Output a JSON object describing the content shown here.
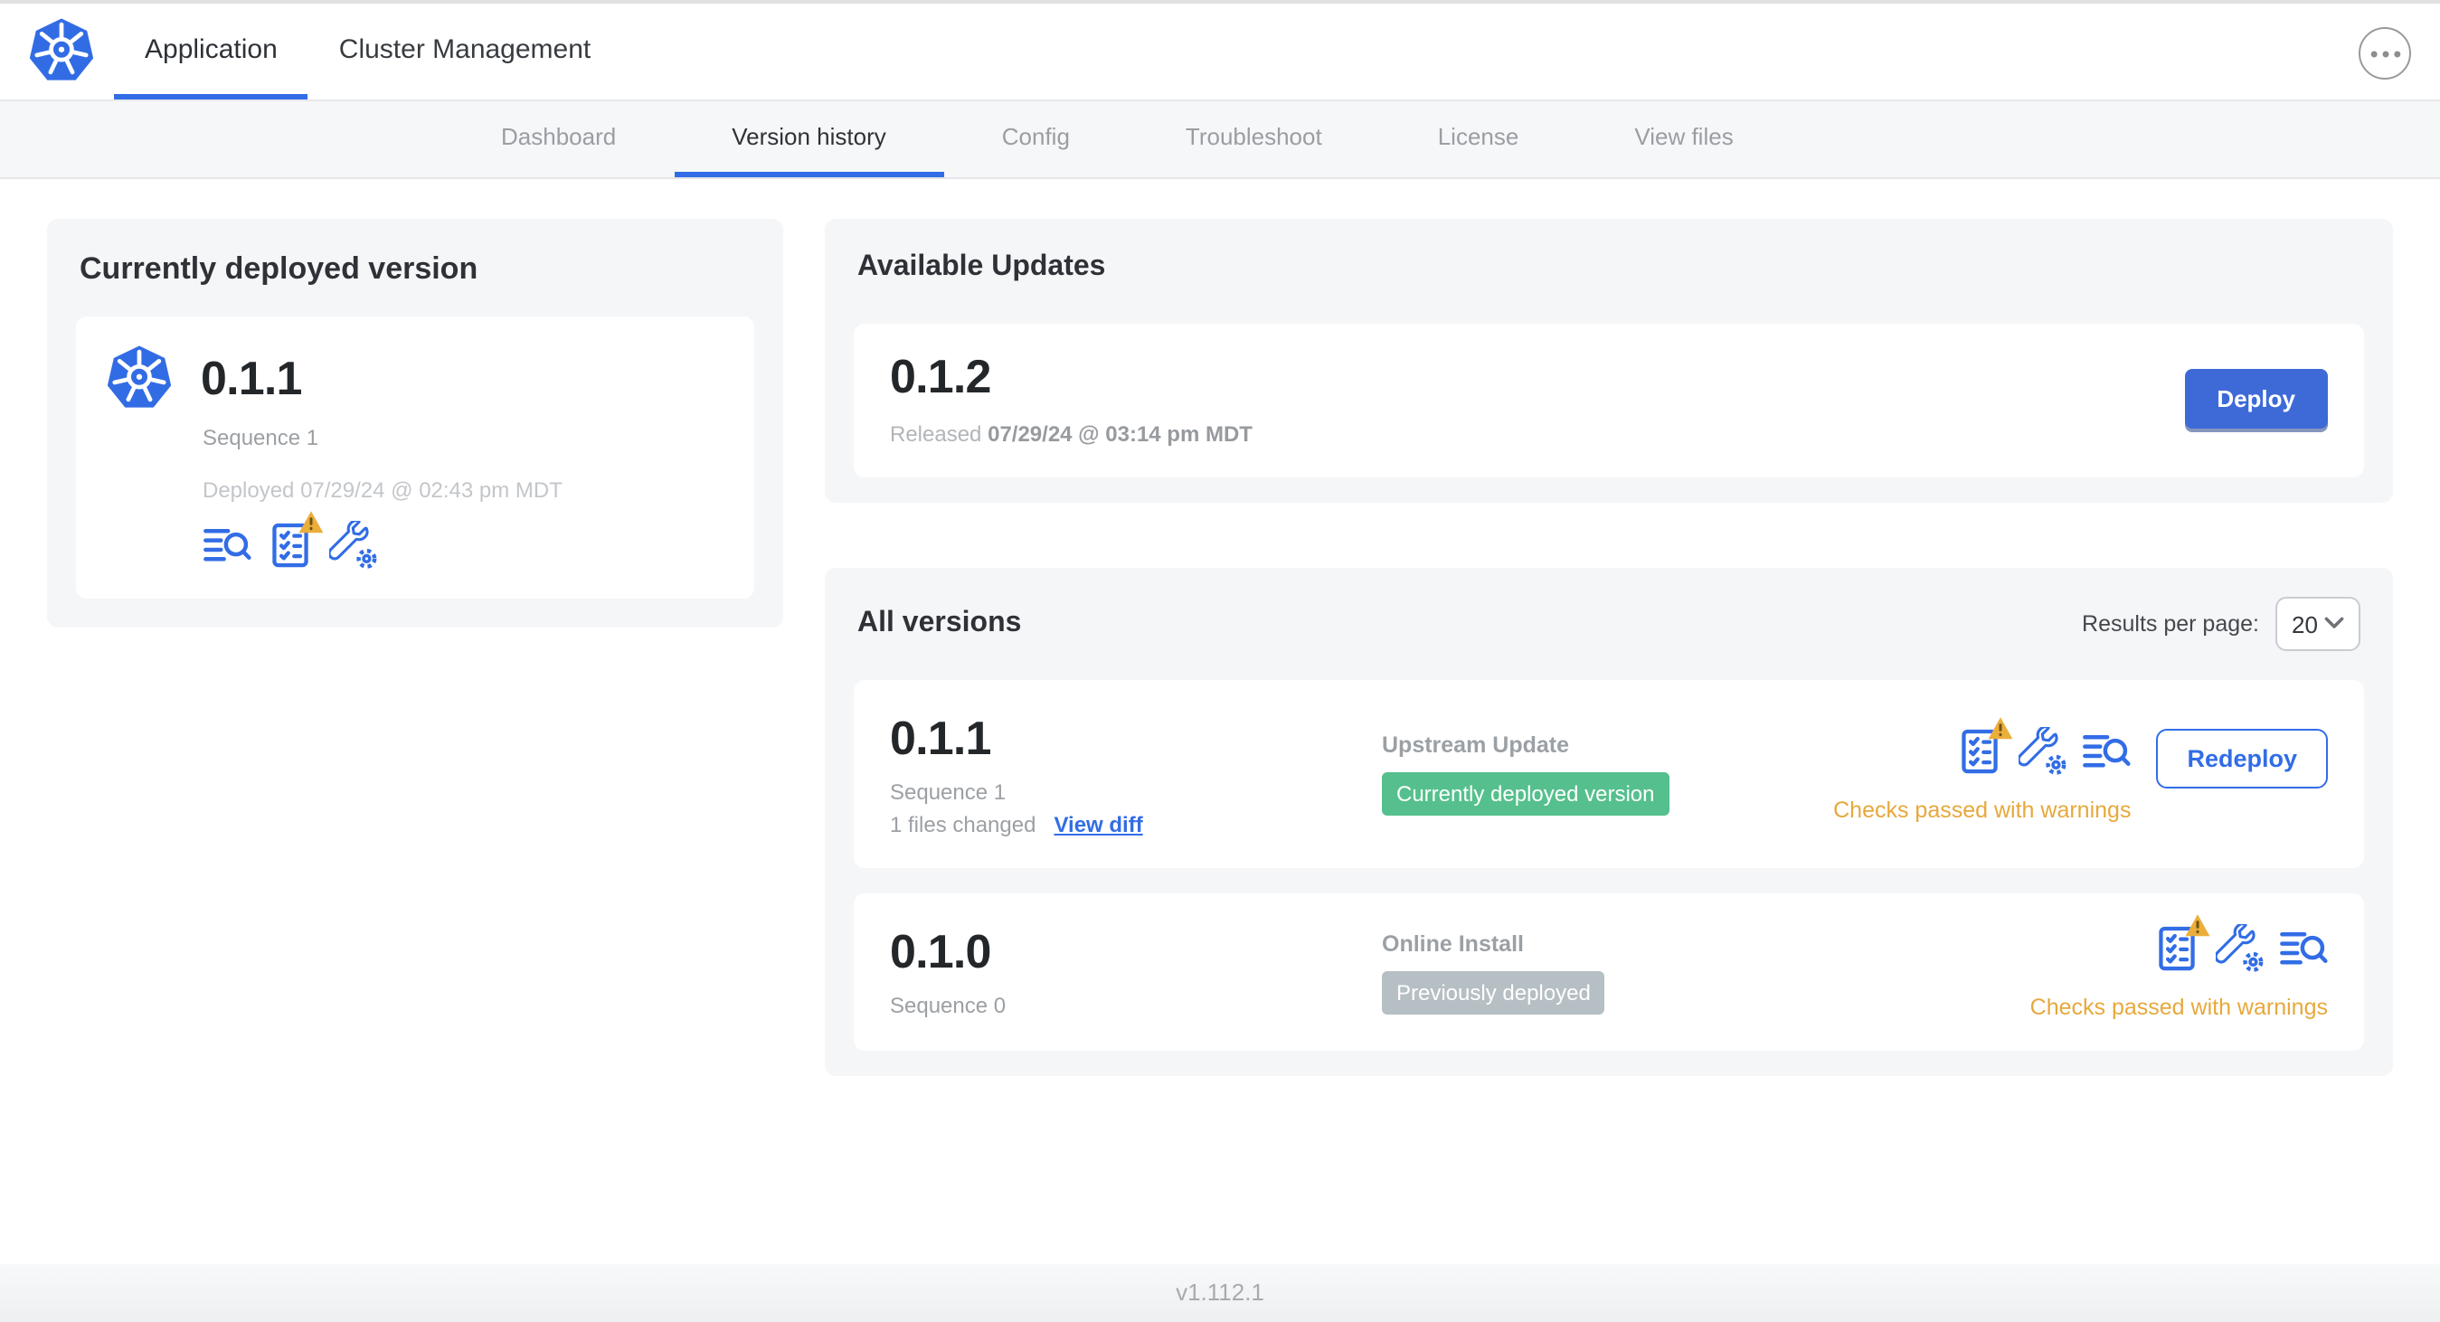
{
  "header": {
    "tabs": [
      {
        "label": "Application",
        "active": true
      },
      {
        "label": "Cluster Management",
        "active": false
      }
    ]
  },
  "subnav": {
    "tabs": [
      {
        "label": "Dashboard"
      },
      {
        "label": "Version history"
      },
      {
        "label": "Config"
      },
      {
        "label": "Troubleshoot"
      },
      {
        "label": "License"
      },
      {
        "label": "View files"
      }
    ],
    "active_tab": "Version history"
  },
  "current_version": {
    "title": "Currently deployed version",
    "version": "0.1.1",
    "sequence": "Sequence 1",
    "deployed": "Deployed 07/29/24 @ 02:43 pm MDT",
    "icons": [
      "diff-icon",
      "preflight-checks-warning-icon",
      "config-icon"
    ]
  },
  "available_updates": {
    "title": "Available Updates",
    "version": "0.1.2",
    "released_prefix": "Released",
    "released_date": "07/29/24 @ 03:14 pm MDT",
    "deploy_button": "Deploy"
  },
  "all_versions": {
    "title": "All versions",
    "results_per_page_label": "Results per page:",
    "results_per_page_value": "20",
    "rows": [
      {
        "version": "0.1.1",
        "sequence": "Sequence 1",
        "files_changed": "1 files changed",
        "view_diff_link": "View diff",
        "source": "Upstream Update",
        "badge_label": "Currently deployed version",
        "badge_color": "#55c08d",
        "status_text": "Checks passed with warnings",
        "action_button": "Redeploy",
        "icons": [
          "preflight-checks-warning-icon",
          "config-icon",
          "diff-icon"
        ]
      },
      {
        "version": "0.1.0",
        "sequence": "Sequence 0",
        "source": "Online Install",
        "badge_label": "Previously deployed",
        "badge_color": "#b6bfc3",
        "status_text": "Checks passed with warnings",
        "icons": [
          "preflight-checks-warning-icon",
          "config-icon",
          "diff-icon"
        ]
      }
    ]
  },
  "footer": {
    "app_version": "v1.112.1"
  },
  "colors": {
    "accent_blue": "#326de6",
    "button_blue": "#3e6ad8",
    "kubernetes_blue": "#326ce5",
    "success_green": "#55c08d",
    "neutral_badge_gray": "#b6bfc3",
    "warning_amber": "#e7a83b"
  }
}
